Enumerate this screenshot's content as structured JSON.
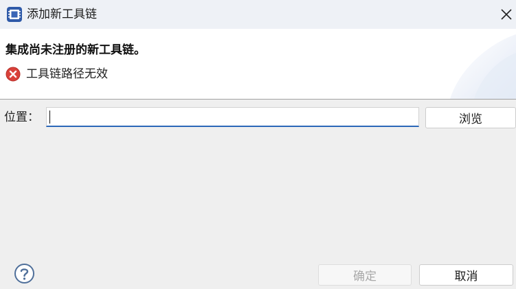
{
  "window": {
    "title": "添加新工具链",
    "title_icon": "cpu-chip-icon",
    "close_icon": "close-icon"
  },
  "header": {
    "title": "集成尚未注册的新工具链。",
    "error_icon": "error-icon",
    "error_message": "工具链路径无效"
  },
  "form": {
    "location_label": "位置：",
    "location_value": "",
    "browse_label": "浏览"
  },
  "footer": {
    "help_icon": "help-icon",
    "ok_label": "确定",
    "ok_enabled": false,
    "cancel_label": "取消"
  },
  "colors": {
    "accent": "#2a67b8",
    "error": "#d9413a",
    "header_bg": "#ffffff",
    "body_bg": "#efefef"
  }
}
